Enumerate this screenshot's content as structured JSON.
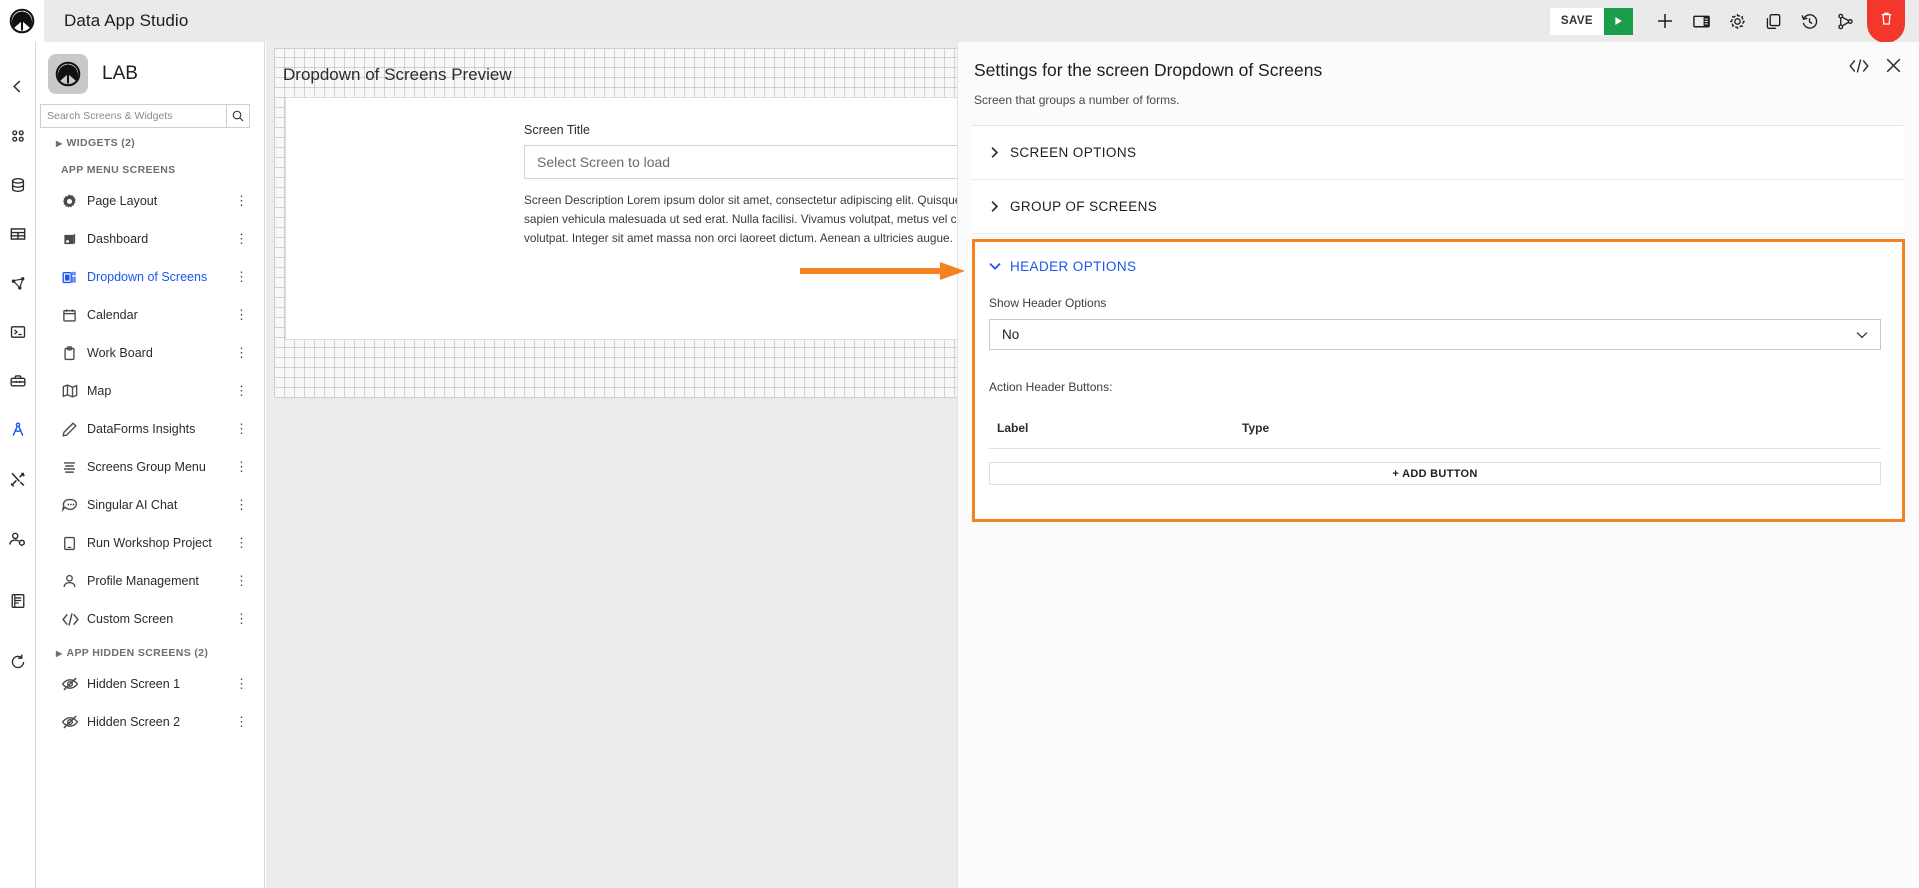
{
  "topbar": {
    "title": "Data App Studio",
    "save_label": "SAVE",
    "actions": [
      {
        "name": "run-button",
        "icon": "play-icon"
      },
      {
        "name": "add-button",
        "icon": "plus-icon"
      },
      {
        "name": "layout-button",
        "icon": "panel-layout-icon"
      },
      {
        "name": "settings-button",
        "icon": "gear-icon"
      },
      {
        "name": "copy-button",
        "icon": "copy-icon"
      },
      {
        "name": "history-button",
        "icon": "history-icon"
      },
      {
        "name": "branch-button",
        "icon": "git-branch-icon"
      },
      {
        "name": "delete-button",
        "icon": "trash-icon"
      }
    ],
    "accent_green": "#1a9e4b",
    "accent_red": "#f4372c"
  },
  "rail": {
    "items": [
      {
        "name": "collapse-icon",
        "label": "Collapse"
      },
      {
        "name": "apps-grid-icon",
        "label": "Apps"
      },
      {
        "name": "database-icon",
        "label": "Data"
      },
      {
        "name": "table-icon",
        "label": "Tables"
      },
      {
        "name": "graph-network-icon",
        "label": "Network"
      },
      {
        "name": "terminal-icon",
        "label": "Terminal"
      },
      {
        "name": "toolbox-icon",
        "label": "Toolbox"
      },
      {
        "name": "compass-icon",
        "label": "Studio"
      },
      {
        "name": "tools-icon",
        "label": "Tools"
      },
      {
        "name": "user-settings-icon",
        "label": "Users"
      },
      {
        "name": "book-icon",
        "label": "Docs"
      },
      {
        "name": "refresh-icon",
        "label": "Refresh"
      }
    ]
  },
  "sidebar": {
    "app_name": "LAB",
    "search_placeholder": "Search Screens & Widgets",
    "search_value": "",
    "widgets_section": "WIDGETS (2)",
    "menu_section": "APP MENU SCREENS",
    "hidden_section": "APP HIDDEN SCREENS (2)",
    "items": [
      {
        "label": "Page Layout",
        "icon": "gear-burst-icon",
        "active": false
      },
      {
        "label": "Dashboard",
        "icon": "dashboard-icon",
        "active": false
      },
      {
        "label": "Dropdown of Screens",
        "icon": "dropdown-screens-icon",
        "active": true
      },
      {
        "label": "Calendar",
        "icon": "calendar-icon",
        "active": false
      },
      {
        "label": "Work Board",
        "icon": "clipboard-icon",
        "active": false
      },
      {
        "label": "Map",
        "icon": "map-icon",
        "active": false
      },
      {
        "label": "DataForms Insights",
        "icon": "pencil-icon",
        "active": false
      },
      {
        "label": "Screens Group Menu",
        "icon": "menu-lines-icon",
        "active": false
      },
      {
        "label": "Singular AI Chat",
        "icon": "chat-bubble-icon",
        "active": false
      },
      {
        "label": "Run Workshop Project",
        "icon": "tablet-icon",
        "active": false
      },
      {
        "label": "Profile Management",
        "icon": "person-icon",
        "active": false
      },
      {
        "label": "Custom Screen",
        "icon": "code-icon",
        "active": false
      }
    ],
    "hidden_items": [
      {
        "label": "Hidden Screen 1",
        "icon": "eye-off-icon"
      },
      {
        "label": "Hidden Screen 2",
        "icon": "eye-off-icon"
      }
    ],
    "kebab_glyph": "⋮"
  },
  "canvas": {
    "preview_title": "Dropdown of Screens Preview",
    "screen_title_label": "Screen Title",
    "select_placeholder": "Select Screen to load",
    "description": "Screen Description Lorem ipsum dolor sit amet, consectetur adipiscing elit. Quisque ultricies, ex nec ultrices dapibus, turpis velit nec sapien vehicula malesuada ut sed erat. Nulla facilisi. Vivamus volutpat, metus vel congue vehicula, nunc massa tincidunt erat volutpat. Integer sit amet massa non orci laoreet dictum. Aenean a ultricies augue. Donec gravida."
  },
  "panel": {
    "title": "Settings for the screen Dropdown of Screens",
    "subtitle": "Screen that groups a number of forms.",
    "code_icon": "code-brackets-icon",
    "close_icon": "close-icon",
    "sections": [
      {
        "label": "SCREEN OPTIONS",
        "expanded": false
      },
      {
        "label": "GROUP OF SCREENS",
        "expanded": false
      }
    ],
    "header_options": {
      "label": "HEADER OPTIONS",
      "expanded": true,
      "highlight_color": "#f58220",
      "accent_color": "#1a56f0",
      "show_header_label": "Show Header Options",
      "show_header_value": "No",
      "action_buttons_label": "Action Header Buttons:",
      "table_headers": [
        "Label",
        "Type"
      ],
      "table_rows": [],
      "add_button_label": "+ ADD BUTTON"
    }
  },
  "annotation": {
    "arrow_color": "#f58220",
    "points_to": "HEADER OPTIONS"
  }
}
